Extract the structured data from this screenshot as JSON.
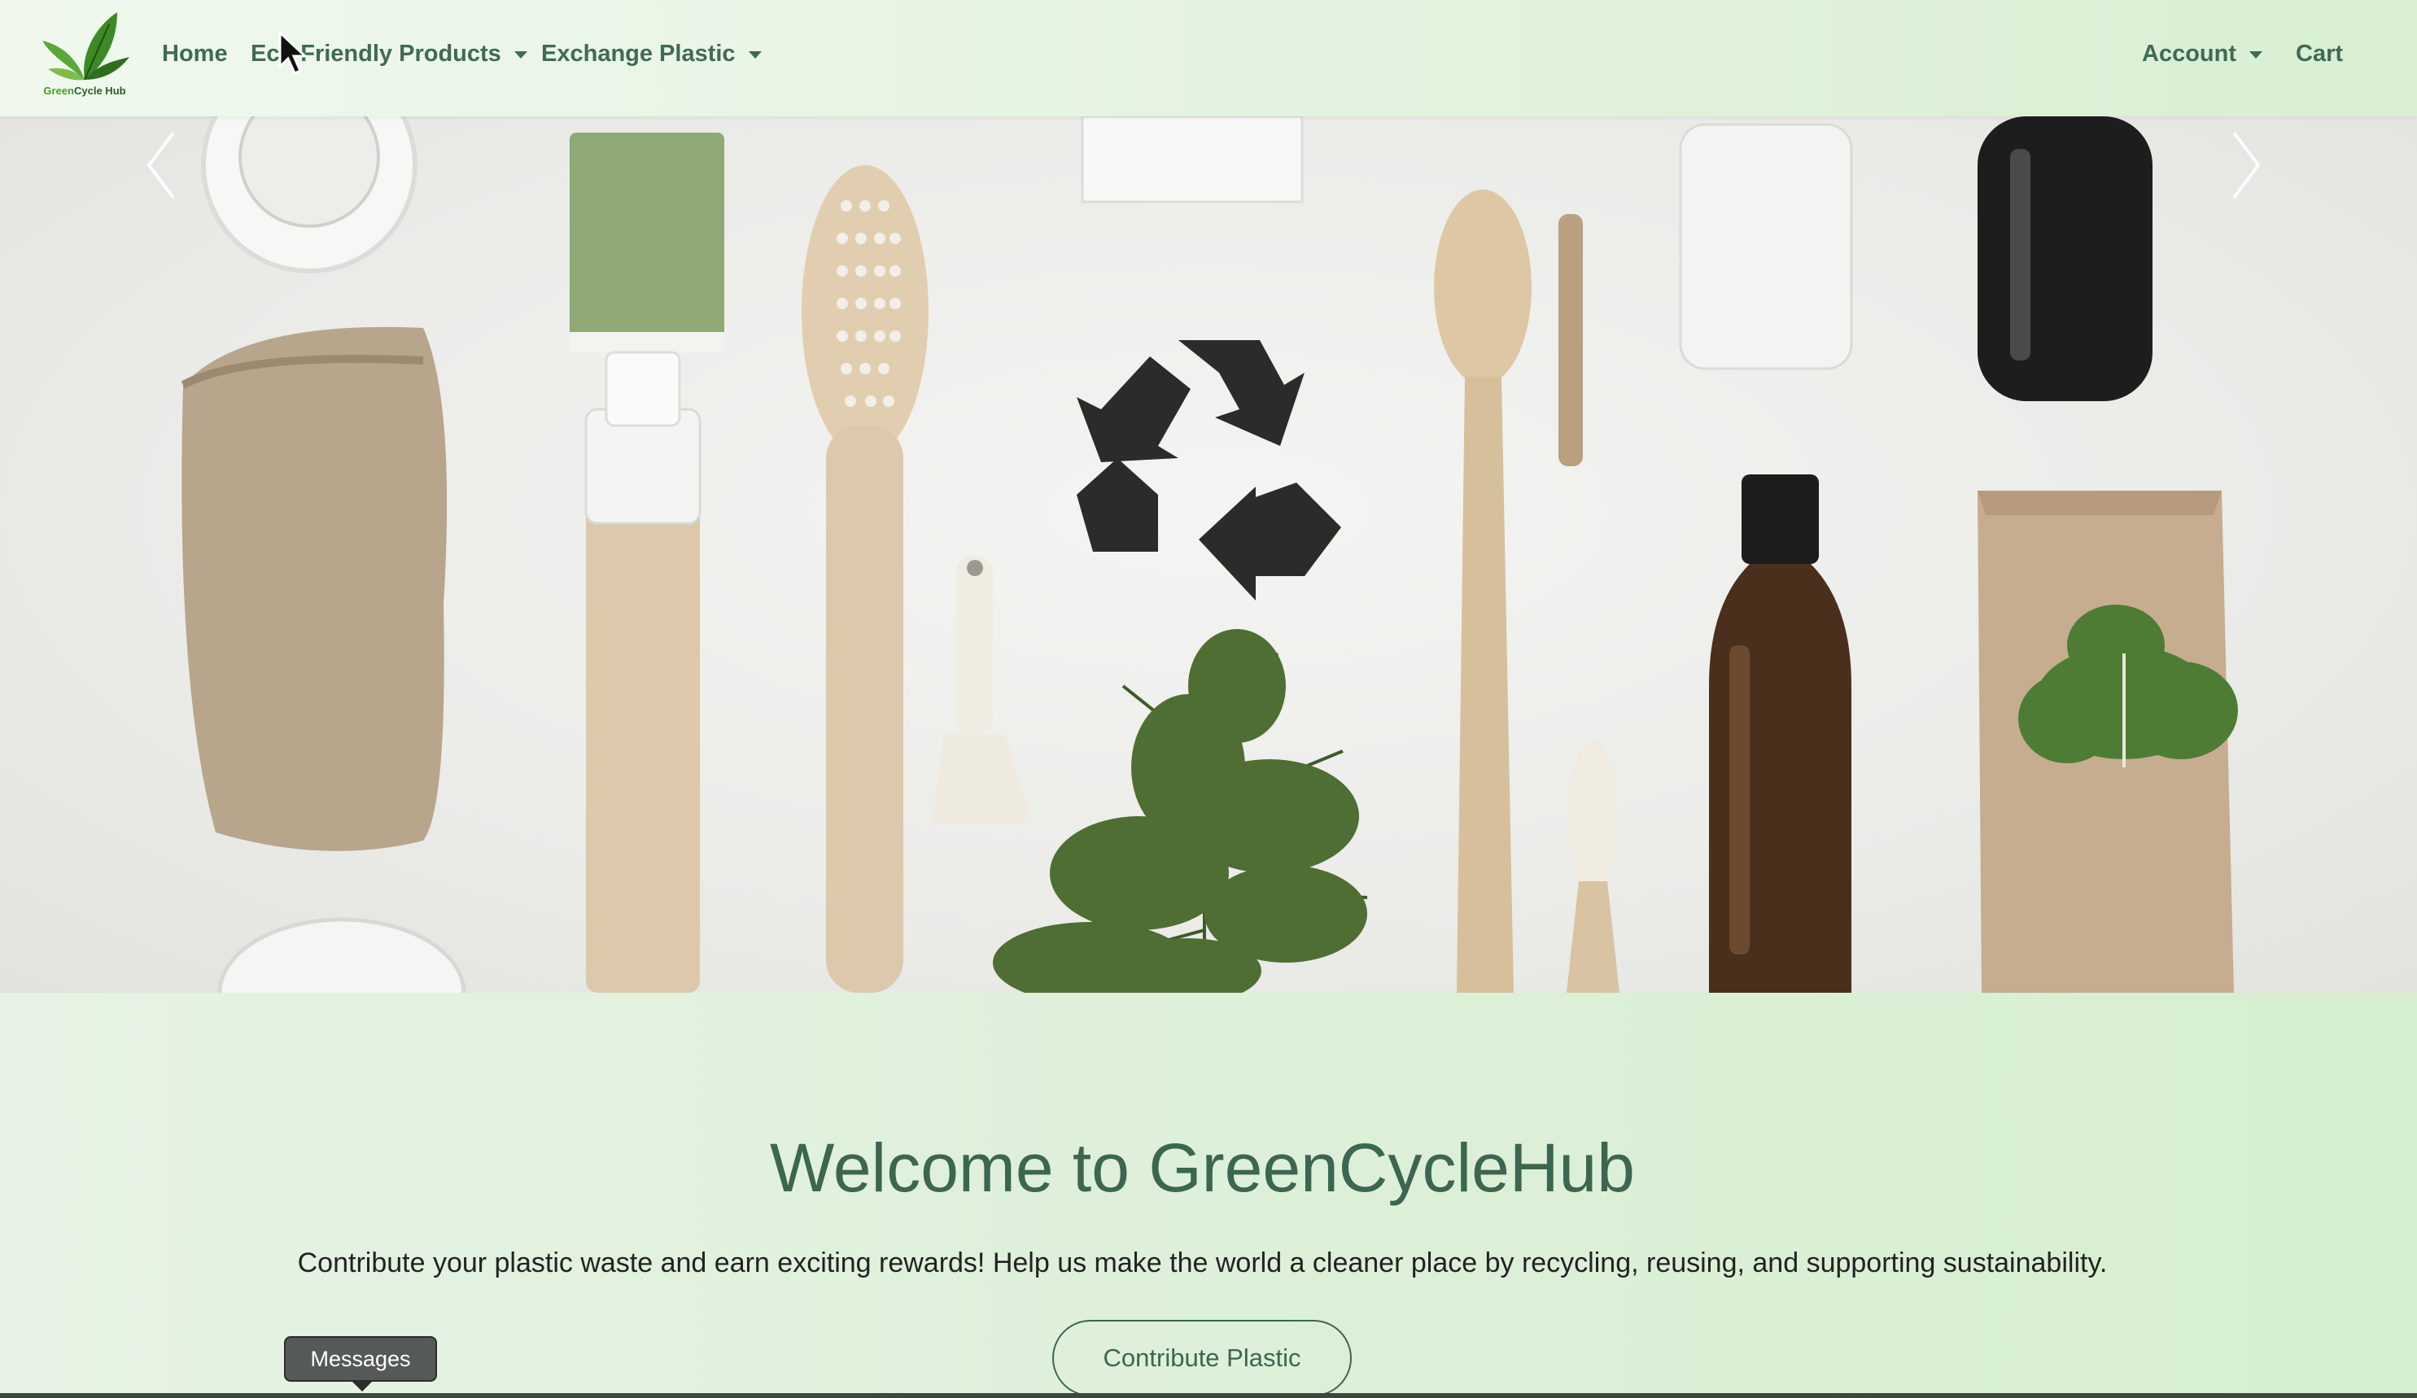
{
  "brand": {
    "logo_text_green": "Green",
    "logo_text_rest": "Cycle Hub"
  },
  "nav": {
    "home": "Home",
    "eco_products": "Eco Friendly Products",
    "exchange_plastic": "Exchange Plastic",
    "account": "Account",
    "cart": "Cart"
  },
  "hero": {
    "prev_icon": "chevron-left-icon",
    "next_icon": "chevron-right-icon",
    "center_icon": "recycle-icon"
  },
  "welcome": {
    "title": "Welcome to GreenCycleHub",
    "subtitle": "Contribute your plastic waste and earn exciting rewards! Help us make the world a cleaner place by recycling, reusing, and supporting sustainability.",
    "button": "Contribute Plastic"
  },
  "tooltip": {
    "text": "Messages"
  },
  "colors": {
    "accent": "#3c6650",
    "nav_text": "#3f6a56",
    "background": "#e2f2dd"
  }
}
